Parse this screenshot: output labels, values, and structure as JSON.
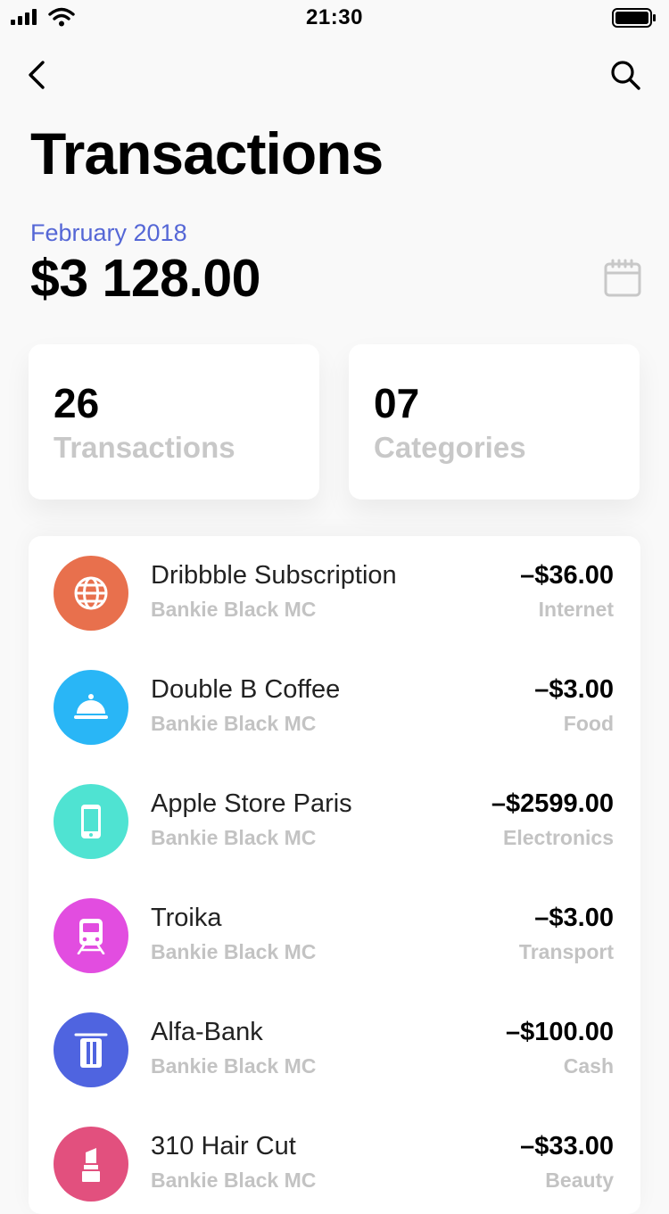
{
  "status_bar": {
    "time": "21:30"
  },
  "header": {
    "title": "Transactions",
    "month": "February 2018",
    "total": "$3 128.00"
  },
  "stats": [
    {
      "value": "26",
      "label": "Transactions"
    },
    {
      "value": "07",
      "label": "Categories"
    }
  ],
  "transactions": [
    {
      "name": "Dribbble Subscription",
      "card": "Bankie Black MC",
      "amount": "–$36.00",
      "category": "Internet",
      "icon": "globe-icon",
      "color": "#e8704d"
    },
    {
      "name": "Double B Coffee",
      "card": "Bankie Black MC",
      "amount": "–$3.00",
      "category": "Food",
      "icon": "cloche-icon",
      "color": "#29b6f6"
    },
    {
      "name": "Apple Store Paris",
      "card": "Bankie Black MC",
      "amount": "–$2599.00",
      "category": "Electronics",
      "icon": "phone-icon",
      "color": "#4fe3d2"
    },
    {
      "name": "Troika",
      "card": "Bankie Black MC",
      "amount": "–$3.00",
      "category": "Transport",
      "icon": "train-icon",
      "color": "#e24de0"
    },
    {
      "name": "Alfa-Bank",
      "card": "Bankie Black MC",
      "amount": "–$100.00",
      "category": "Cash",
      "icon": "atm-card-icon",
      "color": "#4f64e0"
    },
    {
      "name": "310 Hair Cut",
      "card": "Bankie Black MC",
      "amount": "–$33.00",
      "category": "Beauty",
      "icon": "lipstick-icon",
      "color": "#e2507e"
    }
  ]
}
